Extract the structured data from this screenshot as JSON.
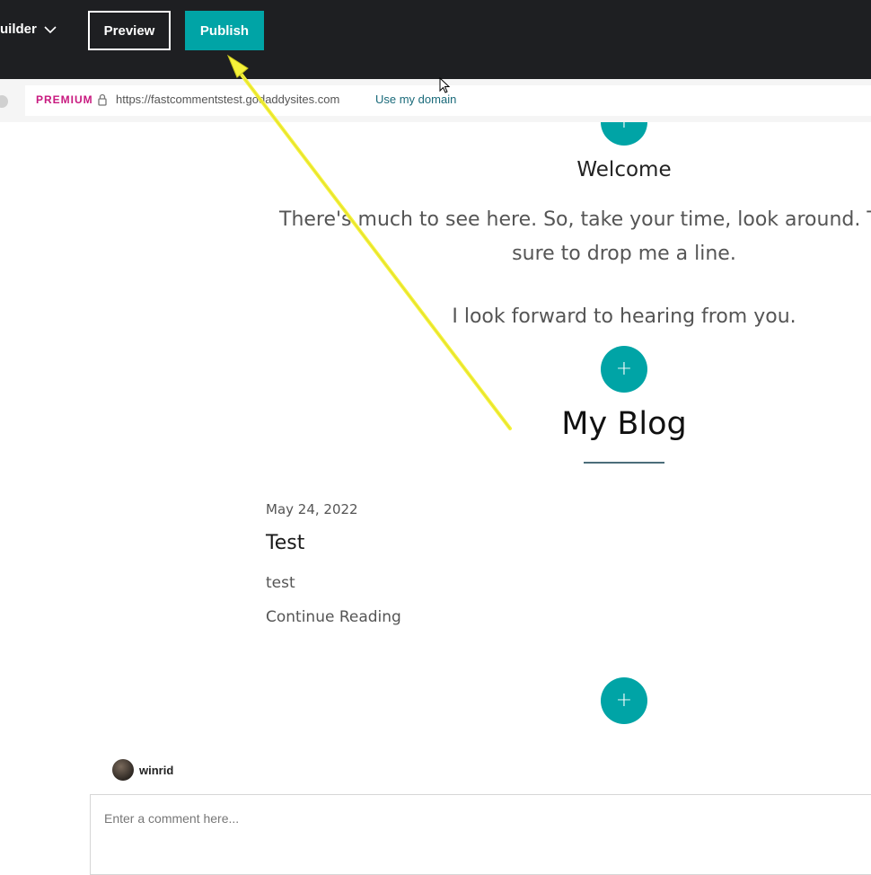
{
  "topbar": {
    "builder_label": "uilder",
    "preview_label": "Preview",
    "publish_label": "Publish"
  },
  "urlbar": {
    "plan_badge": "PREMIUM",
    "site_url": "https://fastcommentstest.godaddysites.com",
    "domain_link": "Use my domain"
  },
  "welcome": {
    "heading": "Welcome",
    "line1": "There's much to see here. So, take your time, look around. Th",
    "line2": "sure to drop me a line.",
    "line3": "I look forward to hearing from you."
  },
  "blog": {
    "heading": "My Blog",
    "post": {
      "date": "May 24, 2022",
      "title": "Test",
      "excerpt": "test",
      "continue": "Continue Reading"
    }
  },
  "add_section_symbol": "+",
  "comment": {
    "username": "winrid",
    "placeholder": "Enter a comment here..."
  },
  "colors": {
    "topbar": "#1e1f22",
    "accent": "#00a4a6",
    "premium": "#c8197f",
    "annotation_arrow": "#f5f23a"
  },
  "icons": [
    "chevron-down-icon",
    "lock-icon",
    "plus-icon",
    "mouse-cursor-icon",
    "annotation-arrow"
  ]
}
